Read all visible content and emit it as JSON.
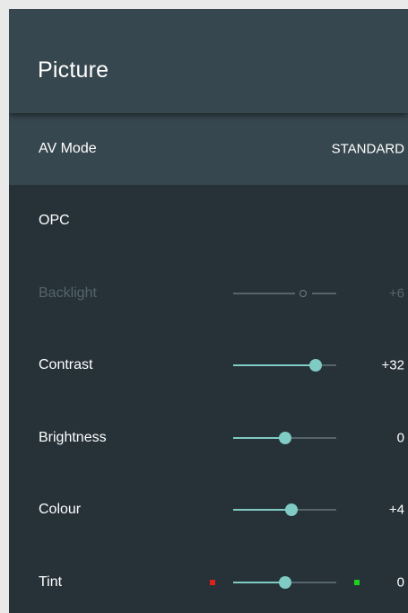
{
  "header": {
    "title": "Picture"
  },
  "colors": {
    "accent": "#80cbc4",
    "panel_bg": "#263238",
    "header_bg": "#37474f",
    "tint_left": "#e0201a",
    "tint_right": "#1ed01e"
  },
  "items": [
    {
      "label": "AV Mode",
      "value": "STANDARD"
    },
    {
      "label": "OPC",
      "value": ""
    },
    {
      "label": "Backlight",
      "value": "+6",
      "enabled": false,
      "level": 0.68
    },
    {
      "label": "Contrast",
      "value": "+32",
      "level": 0.8
    },
    {
      "label": "Brightness",
      "value": "0",
      "level": 0.5
    },
    {
      "label": "Colour",
      "value": "+4",
      "level": 0.565
    },
    {
      "label": "Tint",
      "value": "0",
      "level": 0.5
    }
  ]
}
